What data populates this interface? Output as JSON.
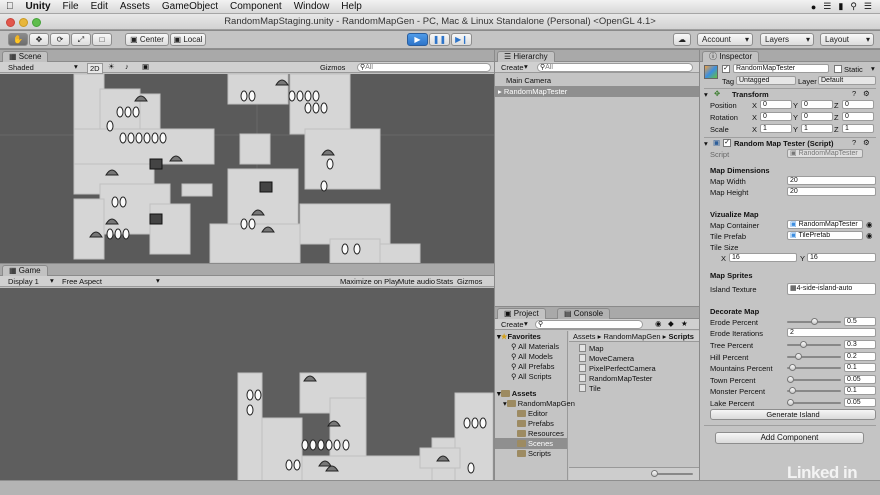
{
  "menubar": {
    "app_name": "Unity",
    "items": [
      "File",
      "Edit",
      "Assets",
      "GameObject",
      "Component",
      "Window",
      "Help"
    ]
  },
  "window": {
    "title": "RandomMapStaging.unity - RandomMapGen - PC, Mac & Linux Standalone (Personal) <OpenGL 4.1>"
  },
  "toolbar": {
    "pivot_label": "Center",
    "space_label": "Local",
    "account_label": "Account",
    "layers_label": "Layers",
    "layout_label": "Layout"
  },
  "scene": {
    "tab": "Scene",
    "shading": "Shaded",
    "mode_2d": "2D",
    "gizmos": "Gizmos",
    "search_placeholder": "All"
  },
  "game": {
    "tab": "Game",
    "display": "Display 1",
    "aspect": "Free Aspect",
    "maximize": "Maximize on Play",
    "mute": "Mute audio",
    "stats": "Stats",
    "gizmos": "Gizmos"
  },
  "hierarchy": {
    "tab": "Hierarchy",
    "create": "Create",
    "search_placeholder": "All",
    "items": [
      "Main Camera",
      "RandomMapTester"
    ]
  },
  "project": {
    "tab": "Project",
    "console_tab": "Console",
    "create": "Create",
    "favorites_label": "Favorites",
    "favorites": [
      "All Materials",
      "All Models",
      "All Prefabs",
      "All Scripts"
    ],
    "assets_label": "Assets",
    "tree": [
      "RandomMapGen",
      "Editor",
      "Prefabs",
      "Resources",
      "Scenes",
      "Scripts"
    ],
    "breadcrumb": [
      "Assets",
      "RandomMapGen",
      "Scripts"
    ],
    "files": [
      "Map",
      "MoveCamera",
      "PixelPerfectCamera",
      "RandomMapTester",
      "Tile"
    ]
  },
  "inspector": {
    "tab": "Inspector",
    "object_name": "RandomMapTester",
    "static_label": "Static",
    "tag_label": "Tag",
    "tag_value": "Untagged",
    "layer_label": "Layer",
    "layer_value": "Default",
    "transform": {
      "title": "Transform",
      "rows": [
        {
          "label": "Position",
          "x": "0",
          "y": "0",
          "z": "0"
        },
        {
          "label": "Rotation",
          "x": "0",
          "y": "0",
          "z": "0"
        },
        {
          "label": "Scale",
          "x": "1",
          "y": "1",
          "z": "1"
        }
      ]
    },
    "script_component": {
      "title": "Random Map Tester (Script)",
      "script_label": "Script",
      "script_value": "RandomMapTester"
    },
    "map_dimensions": {
      "header": "Map Dimensions",
      "width_label": "Map Width",
      "width_value": "20",
      "height_label": "Map Height",
      "height_value": "20"
    },
    "visualize": {
      "header": "Vizualize Map",
      "container_label": "Map Container",
      "container_value": "RandomMapTester",
      "prefab_label": "Tile Prefab",
      "prefab_value": "TilePrefab",
      "tile_size_label": "Tile Size",
      "tile_x_label": "X",
      "tile_x": "16",
      "tile_y_label": "Y",
      "tile_y": "16"
    },
    "sprites": {
      "header": "Map Sprites",
      "island_label": "Island Texture",
      "island_value": "4-side-island-auto"
    },
    "decorate": {
      "header": "Decorate Map",
      "erode_percent_label": "Erode Percent",
      "erode_percent": "0.5",
      "erode_iterations_label": "Erode Iterations",
      "erode_iterations": "2",
      "rows": [
        {
          "label": "Tree Percent",
          "value": "0.3",
          "fraction": 0.3
        },
        {
          "label": "Hill Percent",
          "value": "0.2",
          "fraction": 0.2
        },
        {
          "label": "Mountains Percent",
          "value": "0.1",
          "fraction": 0.1
        },
        {
          "label": "Town Percent",
          "value": "0.05",
          "fraction": 0.05
        },
        {
          "label": "Monster Percent",
          "value": "0.1",
          "fraction": 0.1
        },
        {
          "label": "Lake Percent",
          "value": "0.05",
          "fraction": 0.05
        }
      ],
      "generate_button": "Generate Island"
    },
    "add_component": "Add Component"
  },
  "watermark": "Linked in"
}
